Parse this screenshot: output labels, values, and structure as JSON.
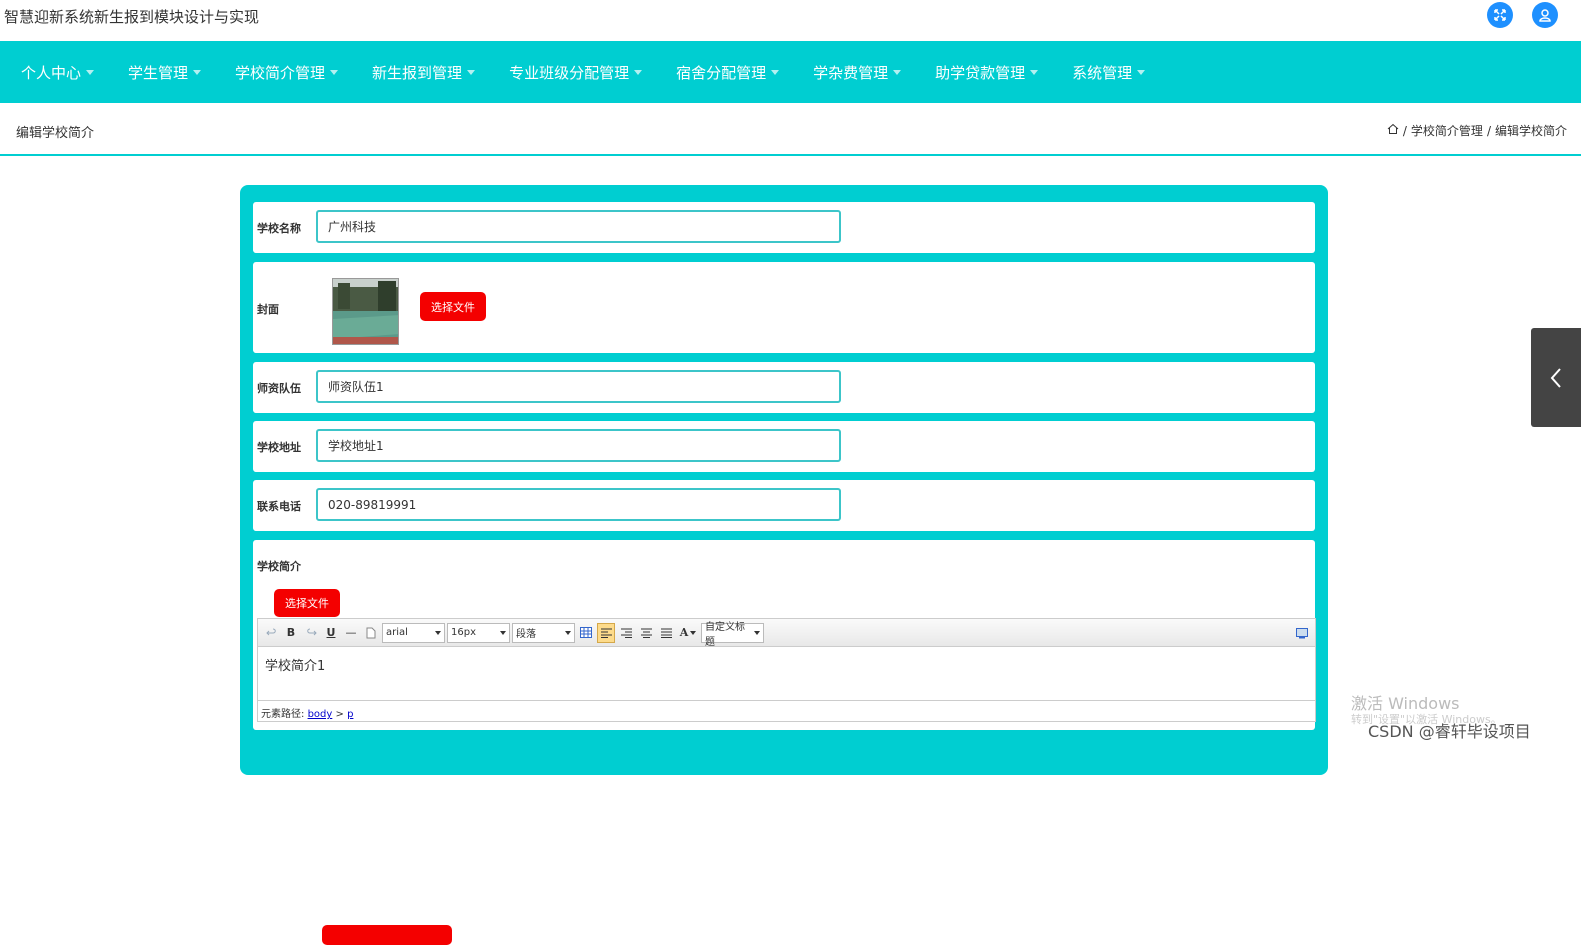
{
  "app": {
    "title": "智慧迎新系统新生报到模块设计与实现"
  },
  "nav": {
    "items": [
      {
        "label": "个人中心"
      },
      {
        "label": "学生管理"
      },
      {
        "label": "学校简介管理"
      },
      {
        "label": "新生报到管理"
      },
      {
        "label": "专业班级分配管理"
      },
      {
        "label": "宿舍分配管理"
      },
      {
        "label": "学杂费管理"
      },
      {
        "label": "助学贷款管理"
      },
      {
        "label": "系统管理"
      }
    ]
  },
  "page": {
    "title": "编辑学校简介",
    "breadcrumb": {
      "sep1": "/",
      "section": "学校简介管理",
      "sep2": "/",
      "current": "编辑学校简介"
    }
  },
  "form": {
    "school_name": {
      "label": "学校名称",
      "value": "广州科技"
    },
    "cover": {
      "label": "封面",
      "button": "选择文件"
    },
    "faculty": {
      "label": "师资队伍",
      "value": "师资队伍1"
    },
    "address": {
      "label": "学校地址",
      "value": "学校地址1"
    },
    "phone": {
      "label": "联系电话",
      "value": "020-89819991"
    },
    "intro": {
      "label": "学校简介",
      "button": "选择文件",
      "toolbar": {
        "bold": "B",
        "underline": "U",
        "hr": "—",
        "font_family": "arial",
        "font_size": "16px",
        "paragraph": "段落",
        "font_color": "A",
        "custom_title": "自定义标题"
      },
      "content": "学校简介1",
      "path_label": "元素路径:",
      "path_body": "body",
      "path_sep": ">",
      "path_p": "p"
    }
  },
  "overlay": {
    "windows_line1": "激活 Windows",
    "windows_line2": "转到\"设置\"以激活 Windows。",
    "csdn": "CSDN @睿轩毕设项目"
  },
  "colors": {
    "primary": "#00ced1",
    "danger": "#f40000",
    "icon_blue": "#1e90ff"
  }
}
